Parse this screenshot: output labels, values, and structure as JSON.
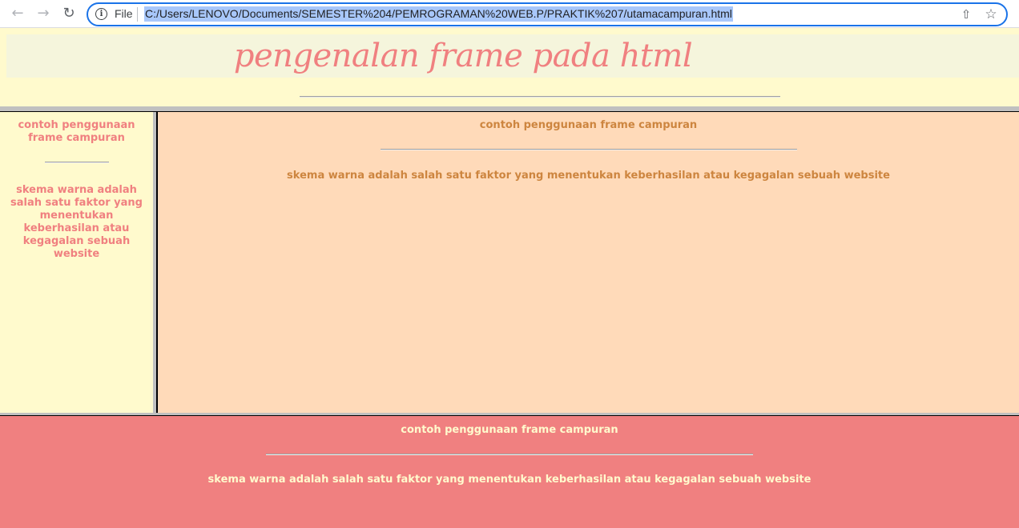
{
  "browser": {
    "file_label": "File",
    "url": "C:/Users/LENOVO/Documents/SEMESTER%204/PEMROGRAMAN%20WEB.P/PRAKTIK%207/utamacampuran.html",
    "back_icon": "arrow-left-icon",
    "forward_icon": "arrow-right-icon",
    "reload_icon": "reload-icon",
    "info_icon": "info-icon",
    "share_icon": "share-icon",
    "bookmark_icon": "star-icon"
  },
  "top_frame": {
    "title": "pengenalan frame pada html",
    "background": "#fffacd",
    "title_color": "#f08080"
  },
  "left_frame": {
    "heading": "contoh penggunaan frame campuran",
    "text": "skema warna adalah salah satu faktor yang menentukan keberhasilan atau kegagalan sebuah website",
    "background": "#fffacd",
    "text_color": "#f08080"
  },
  "main_frame": {
    "heading": "contoh penggunaan frame campuran",
    "text": "skema warna adalah salah satu faktor yang menentukan keberhasilan atau kegagalan sebuah website",
    "background": "#ffdab9",
    "text_color": "#cd853f"
  },
  "bottom_frame": {
    "heading": "contoh penggunaan frame campuran",
    "text": "skema warna adalah salah satu faktor yang menentukan keberhasilan atau kegagalan sebuah website",
    "background": "#f08080",
    "text_color": "#fffacd"
  }
}
